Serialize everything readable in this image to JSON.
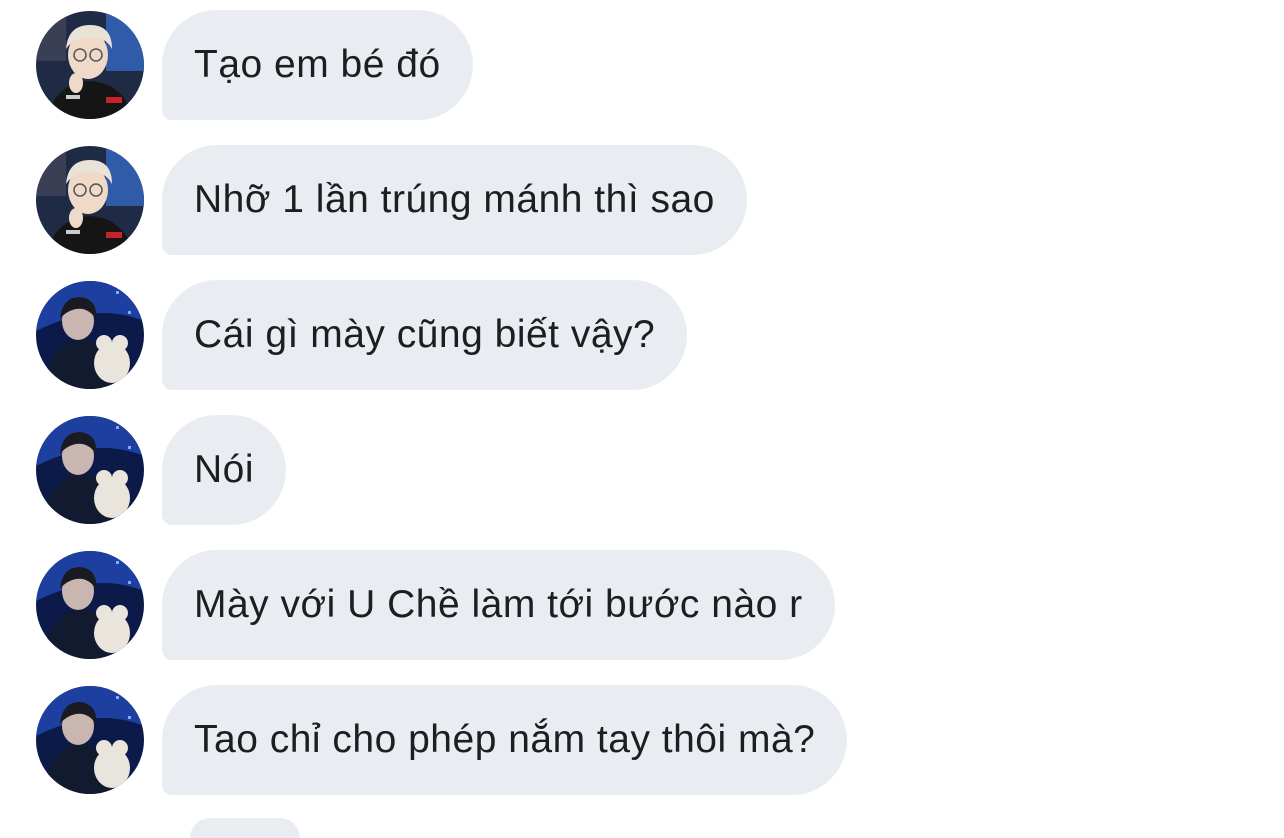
{
  "conversation": {
    "messages": [
      {
        "sender": "contact-a",
        "avatar_icon": "avatar-blonde-glasses",
        "text": "Tạo em bé đó"
      },
      {
        "sender": "contact-a",
        "avatar_icon": "avatar-blonde-glasses",
        "text": "Nhỡ 1 lần trúng mánh thì sao"
      },
      {
        "sender": "contact-b",
        "avatar_icon": "avatar-blue-stage",
        "text": "Cái gì mày cũng biết vậy?"
      },
      {
        "sender": "contact-b",
        "avatar_icon": "avatar-blue-stage",
        "text": "Nói"
      },
      {
        "sender": "contact-b",
        "avatar_icon": "avatar-blue-stage",
        "text": "Mày với U Chề làm tới bước nào r"
      },
      {
        "sender": "contact-b",
        "avatar_icon": "avatar-blue-stage",
        "text": "Tao chỉ cho phép nắm tay thôi mà?"
      }
    ]
  },
  "colors": {
    "bubble_background": "#e9edf1",
    "text": "#1c1e21",
    "page_background": "#ffffff"
  }
}
